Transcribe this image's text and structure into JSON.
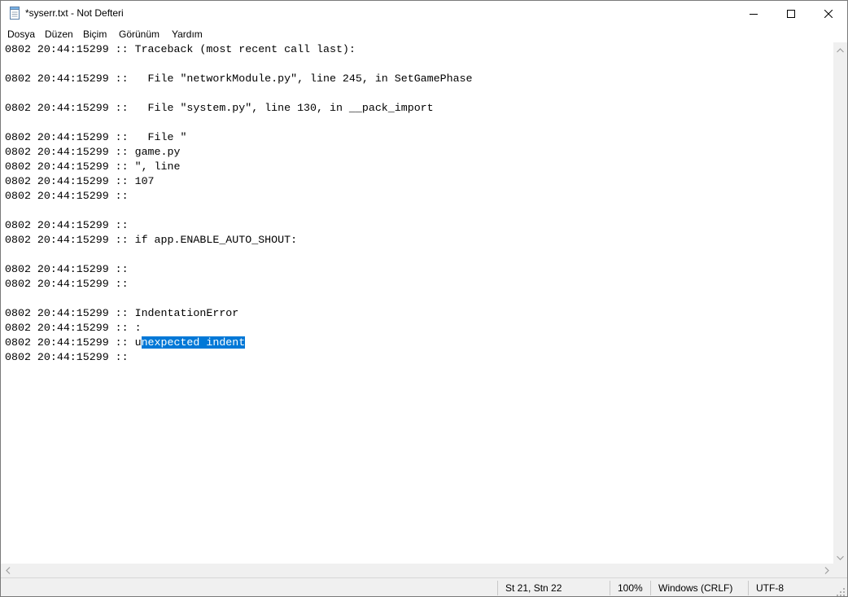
{
  "window": {
    "title": "*syserr.txt - Not Defteri"
  },
  "menu": {
    "items": [
      "Dosya",
      "Düzen",
      "Biçim",
      "Görünüm",
      "Yardım"
    ]
  },
  "editor": {
    "lines": [
      "0802 20:44:15299 :: Traceback (most recent call last):",
      "",
      "0802 20:44:15299 ::   File \"networkModule.py\", line 245, in SetGamePhase",
      "",
      "0802 20:44:15299 ::   File \"system.py\", line 130, in __pack_import",
      "",
      "0802 20:44:15299 ::   File \"",
      "0802 20:44:15299 :: game.py",
      "0802 20:44:15299 :: \", line",
      "0802 20:44:15299 :: 107",
      "0802 20:44:15299 ::",
      "",
      "0802 20:44:15299 ::",
      "0802 20:44:15299 :: if app.ENABLE_AUTO_SHOUT:",
      "",
      "0802 20:44:15299 ::",
      "0802 20:44:15299 ::",
      "",
      "0802 20:44:15299 :: IndentationError",
      "0802 20:44:15299 :: :",
      "0802 20:44:15299 :: unexpected indent",
      "0802 20:44:15299 ::"
    ],
    "selection": {
      "line_index": 20,
      "before": "0802 20:44:15299 :: u",
      "selected": "nexpected indent"
    }
  },
  "status": {
    "position": "St 21, Stn 22",
    "zoom": "100%",
    "line_ending": "Windows (CRLF)",
    "encoding": "UTF-8"
  },
  "colors": {
    "selection_bg": "#0078d7",
    "selection_fg": "#ffffff",
    "statusbar_bg": "#f0f0f0"
  },
  "icons": [
    "notepad-icon",
    "minimize-icon",
    "maximize-icon",
    "close-icon",
    "scroll-up-icon",
    "scroll-down-icon",
    "scroll-left-icon",
    "scroll-right-icon",
    "resize-grip-icon"
  ]
}
